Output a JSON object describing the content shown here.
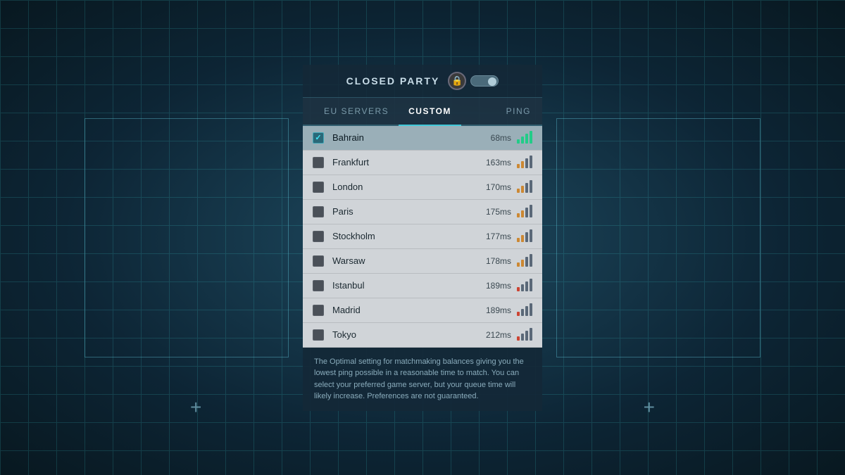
{
  "background": {
    "color": "#1a3a4a"
  },
  "header": {
    "title": "CLOSED PARTY",
    "lock_icon": "🔒"
  },
  "tabs": [
    {
      "id": "eu-servers",
      "label": "EU SERVERS",
      "active": false
    },
    {
      "id": "custom",
      "label": "CUSTOM",
      "active": true
    },
    {
      "id": "ping",
      "label": "PING",
      "active": false
    }
  ],
  "servers": [
    {
      "name": "Bahrain",
      "ping": "68ms",
      "selected": true,
      "signal": "good"
    },
    {
      "name": "Frankfurt",
      "ping": "163ms",
      "selected": false,
      "signal": "medium"
    },
    {
      "name": "London",
      "ping": "170ms",
      "selected": false,
      "signal": "medium"
    },
    {
      "name": "Paris",
      "ping": "175ms",
      "selected": false,
      "signal": "medium"
    },
    {
      "name": "Stockholm",
      "ping": "177ms",
      "selected": false,
      "signal": "medium"
    },
    {
      "name": "Warsaw",
      "ping": "178ms",
      "selected": false,
      "signal": "medium"
    },
    {
      "name": "Istanbul",
      "ping": "189ms",
      "selected": false,
      "signal": "low"
    },
    {
      "name": "Madrid",
      "ping": "189ms",
      "selected": false,
      "signal": "low"
    },
    {
      "name": "Tokyo",
      "ping": "212ms",
      "selected": false,
      "signal": "low"
    }
  ],
  "footer": {
    "text": "The Optimal setting for matchmaking balances giving you the lowest ping possible in a reasonable time to match. You can select your preferred game server, but your queue time will likely increase. Preferences are not guaranteed."
  },
  "plus_icons": {
    "left": "+",
    "right": "+"
  }
}
